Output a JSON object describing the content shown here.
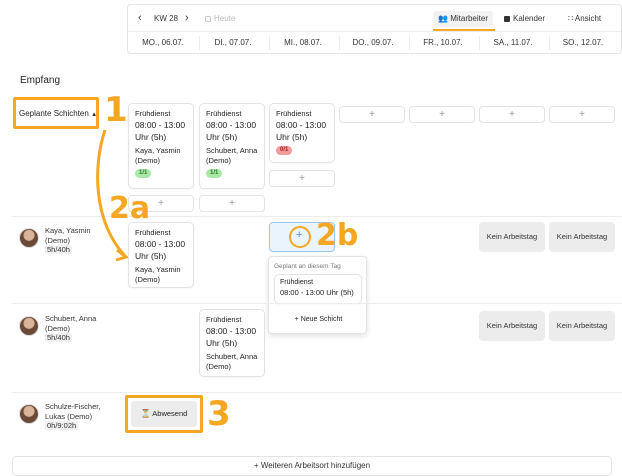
{
  "toolbar": {
    "prev_label": "‹",
    "week_label": "KW 28",
    "next_label": "›",
    "today_label": "Heute",
    "tabs": [
      {
        "label": "Mitarbeiter",
        "icon": "people-icon",
        "active": true
      },
      {
        "label": "Kalender",
        "icon": "calendar-icon",
        "active": false
      }
    ],
    "view_label": "Ansicht",
    "accent_color": "#f5a623"
  },
  "days": [
    "MO., 06.07.",
    "DI., 07.07.",
    "MI., 08.07.",
    "DO., 09.07.",
    "FR., 10.07.",
    "SA., 11.07.",
    "SO., 12.07."
  ],
  "section": {
    "title": "Empfang"
  },
  "planned": {
    "label": "Geplante Schichten",
    "shifts": [
      {
        "name": "Frühdienst",
        "time": "08:00 - 13:00 Uhr (5h)",
        "employee": "Kaya, Yasmin (Demo)",
        "badge": "1/1"
      },
      {
        "name": "Frühdienst",
        "time": "08:00 - 13:00 Uhr (5h)",
        "employee": "Schubert, Anna (Demo)",
        "badge": "1/1"
      },
      {
        "name": "Frühdienst",
        "time": "08:00 - 13:00 Uhr (5h)",
        "badge": "0/1"
      }
    ],
    "plus": "+"
  },
  "employees": [
    {
      "name": "Kaya, Yasmin (Demo)",
      "hours": "5h/40h"
    },
    {
      "name": "Schubert, Anna (Demo)",
      "hours": "5h/40h"
    },
    {
      "name": "Schulze-Fischer, Lukas (Demo)",
      "hours": "0h/9:02h"
    }
  ],
  "row1": {
    "shift": {
      "name": "Frühdienst",
      "time": "08:00 - 13:00 Uhr (5h)",
      "employee": "Kaya, Yasmin (Demo)"
    },
    "popover": {
      "title": "Geplant an diesem Tag",
      "shift_name": "Frühdienst",
      "shift_time": "08:00 - 13:00 Uhr (5h)",
      "new_shift": "+ Neue Schicht"
    },
    "no_workday": "Kein Arbeitstag"
  },
  "row2": {
    "shift": {
      "name": "Frühdienst",
      "time": "08:00 - 13:00 Uhr (5h)",
      "employee": "Schubert, Anna (Demo)"
    },
    "no_workday": "Kein Arbeitstag"
  },
  "row3": {
    "absent_label": "Abwesend"
  },
  "footer": {
    "add_location": "+ Weiteren Arbeitsort hinzufügen"
  },
  "annotations": {
    "n1": "1",
    "n2a": "2a",
    "n2b": "2b",
    "n3": "3"
  }
}
